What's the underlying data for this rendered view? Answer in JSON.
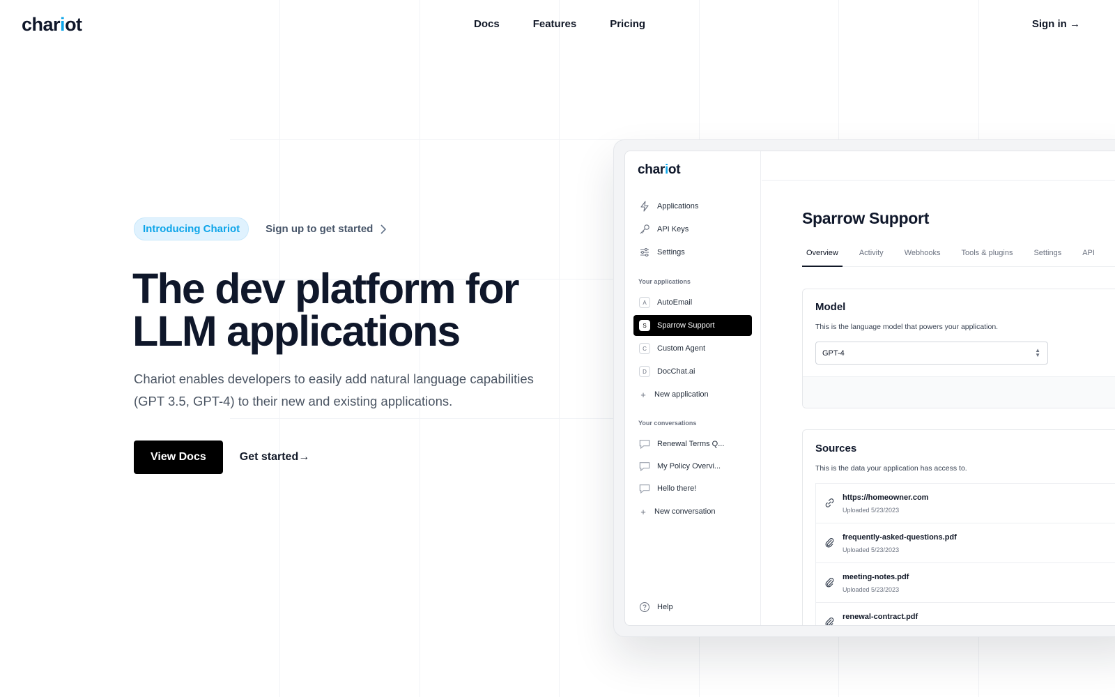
{
  "nav": {
    "logo_prefix": "char",
    "logo_dot": "i",
    "logo_suffix": "ot",
    "links": [
      "Docs",
      "Features",
      "Pricing"
    ],
    "signin": "Sign in →"
  },
  "hero": {
    "badge": "Introducing Chariot",
    "badge_link": "Sign up to get started",
    "title_line1": "The dev platform for",
    "title_line2": "LLM applications",
    "subtitle": "Chariot enables developers to easily add natural language capabilities (GPT 3.5, GPT-4) to their new and existing applications.",
    "primary_cta": "View Docs",
    "secondary_cta": "Get started→"
  },
  "app": {
    "logo_prefix": "char",
    "logo_dot": "i",
    "logo_suffix": "ot",
    "menu": [
      {
        "label": "Applications",
        "icon": "lightning-icon"
      },
      {
        "label": "API Keys",
        "icon": "key-icon"
      },
      {
        "label": "Settings",
        "icon": "sliders-icon"
      }
    ],
    "apps_section": "Your applications",
    "applications": [
      {
        "initial": "A",
        "label": "AutoEmail"
      },
      {
        "initial": "S",
        "label": "Sparrow Support"
      },
      {
        "initial": "C",
        "label": "Custom Agent"
      },
      {
        "initial": "D",
        "label": "DocChat.ai"
      }
    ],
    "new_application": "New application",
    "conv_section": "Your conversations",
    "conversations": [
      "Renewal Terms Q...",
      "My Policy Overvi...",
      "Hello there!"
    ],
    "new_conversation": "New conversation",
    "help": "Help",
    "page_title": "Sparrow Support",
    "tabs": [
      "Overview",
      "Activity",
      "Webhooks",
      "Tools & plugins",
      "Settings",
      "API"
    ],
    "model_card": {
      "title": "Model",
      "desc": "This is the language model that powers your application.",
      "selected": "GPT-4"
    },
    "sources_card": {
      "title": "Sources",
      "desc": "This is the data your application has access to.",
      "files": [
        {
          "name": "https://homeowner.com",
          "date": "Uploaded 5/23/2023",
          "icon": "link-icon"
        },
        {
          "name": "frequently-asked-questions.pdf",
          "date": "Uploaded 5/23/2023",
          "icon": "paperclip-icon"
        },
        {
          "name": "meeting-notes.pdf",
          "date": "Uploaded 5/23/2023",
          "icon": "paperclip-icon"
        },
        {
          "name": "renewal-contract.pdf",
          "date": "",
          "icon": "paperclip-icon"
        }
      ]
    }
  }
}
